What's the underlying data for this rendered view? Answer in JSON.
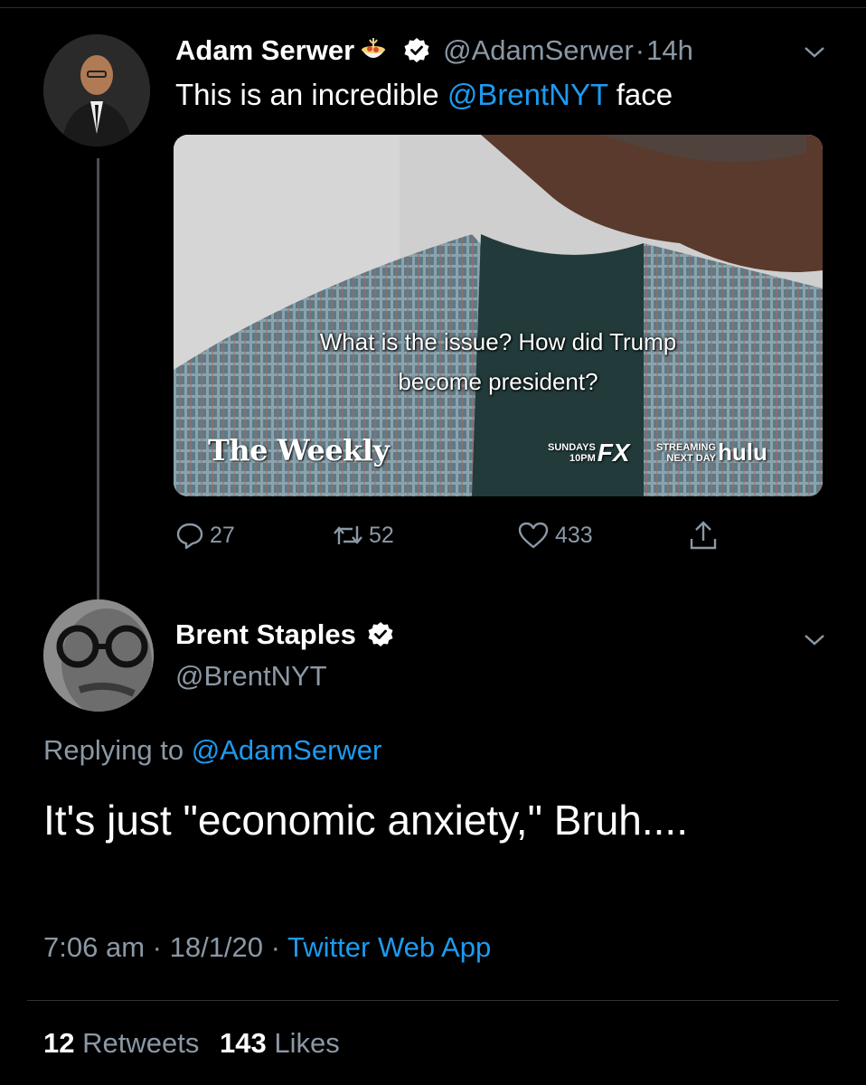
{
  "tweet1": {
    "name": "Adam Serwer",
    "handle": "@AdamSerwer",
    "separator": "·",
    "time": "14h",
    "text_prefix": "This is an incredible ",
    "mention": "@BrentNYT",
    "text_suffix": " face",
    "media": {
      "caption_line1": "What is the issue? How did Trump",
      "caption_line2": "become president?",
      "logo": "The Weekly",
      "fx_small": [
        "SUNDAYS",
        "10PM"
      ],
      "fx_logo": "FX",
      "hulu_small": [
        "STREAMING",
        "NEXT DAY"
      ],
      "hulu_logo": "hulu"
    },
    "actions": {
      "replies": "27",
      "retweets": "52",
      "likes": "433"
    }
  },
  "tweet2": {
    "name": "Brent Staples",
    "handle": "@BrentNYT",
    "replying_label": "Replying to ",
    "replying_to": "@AdamSerwer",
    "text": "It's just \"economic anxiety,\" Bruh....",
    "time": "7:06 am",
    "date": "18/1/20",
    "separator": "·",
    "source": "Twitter Web App",
    "retweets_count": "12",
    "retweets_label": "Retweets",
    "likes_count": "143",
    "likes_label": "Likes"
  },
  "colors": {
    "background": "#000000",
    "accent": "#1d9bf0",
    "muted": "#8b98a5",
    "divider": "#2f3336"
  }
}
